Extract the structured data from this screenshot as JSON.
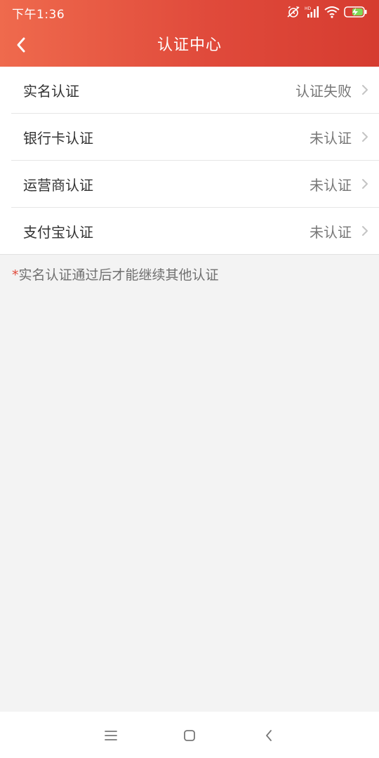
{
  "status_bar": {
    "time": "下午1:36",
    "icons": [
      "alarm-off-icon",
      "hd-signal-icon",
      "wifi-icon",
      "battery-charging-icon"
    ],
    "hd_label": "HD"
  },
  "header": {
    "title": "认证中心",
    "back_icon": "chevron-left-icon"
  },
  "list": {
    "items": [
      {
        "label": "实名认证",
        "status": "认证失败"
      },
      {
        "label": "银行卡认证",
        "status": "未认证"
      },
      {
        "label": "运营商认证",
        "status": "未认证"
      },
      {
        "label": "支付宝认证",
        "status": "未认证"
      }
    ]
  },
  "hint": {
    "star": "*",
    "text": "实名认证通过后才能继续其他认证"
  },
  "nav": {
    "icons": [
      "menu-icon",
      "home-icon",
      "back-icon"
    ]
  },
  "colors": {
    "header_start": "#ef6a4d",
    "header_end": "#d63c30",
    "star": "#e04a3b",
    "background": "#f3f3f3"
  }
}
